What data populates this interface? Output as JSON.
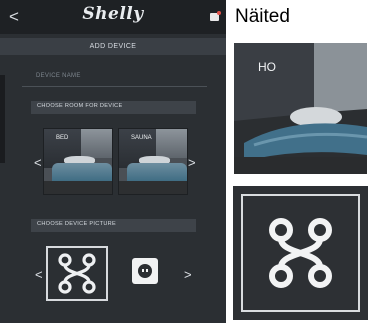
{
  "app": {
    "logo_text": "Shelly",
    "back_glyph": "<",
    "title": "ADD DEVICE",
    "name_field_placeholder": "DEVICE NAME"
  },
  "room_section": {
    "label": "CHOOSE ROOM FOR DEVICE",
    "rooms": [
      "BED",
      "SAUNA"
    ],
    "prev_glyph": "<",
    "next_glyph": ">"
  },
  "picture_section": {
    "label": "CHOOSE DEVICE PICTURE",
    "icons": [
      "relay-icon",
      "socket-icon"
    ],
    "prev_glyph": "<",
    "next_glyph": ">"
  },
  "examples": {
    "heading": "Näited",
    "photo_caption": "HO"
  },
  "colors": {
    "app_background": "#2b2f33",
    "topbar": "#1e2124",
    "accent_red": "#e0524a",
    "bedding_blue": "#3d6b82"
  }
}
